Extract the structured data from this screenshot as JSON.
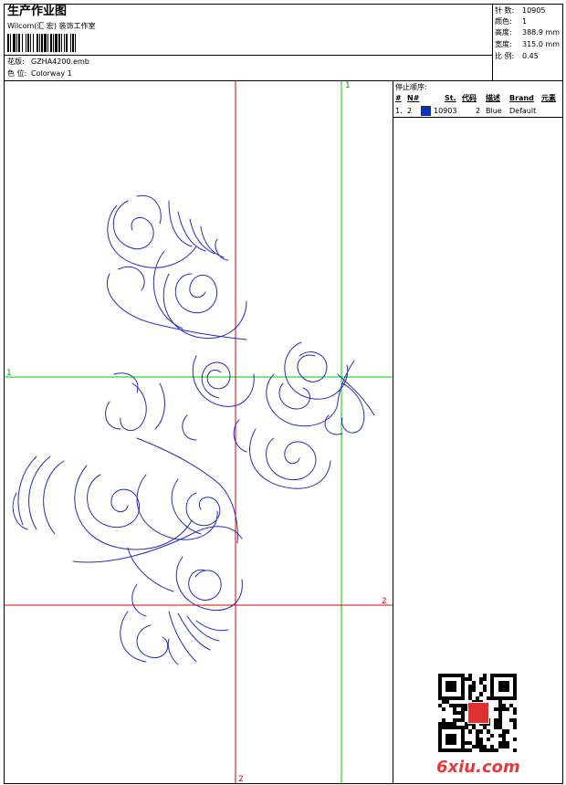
{
  "header": {
    "title": "生产作业图",
    "company": "Wilcom(汇 宏) 装饰工作室",
    "design_label": "花版:",
    "design_value": "GZHA4200.emb",
    "colorway_label": "色 位:",
    "colorway_value": "Colorway 1"
  },
  "specs": [
    {
      "label": "针 数:",
      "value": "10905"
    },
    {
      "label": "颜色:",
      "value": "1"
    },
    {
      "label": "高度:",
      "value": "388.9 mm"
    },
    {
      "label": "宽度:",
      "value": "315.0 mm"
    },
    {
      "label": "比 例:",
      "value": "0.45"
    }
  ],
  "stop_sequence": {
    "title": "停止顺序:",
    "columns": [
      "#",
      "N#",
      "St.",
      "代码",
      "描述",
      "Brand",
      "元素"
    ],
    "rows": [
      {
        "num": "1.",
        "n": "2",
        "color": "#0033cc",
        "stitches": "10903",
        "code": "2",
        "desc": "Blue",
        "brand": "Default"
      }
    ]
  },
  "axes": {
    "top_label": "1",
    "left_label": "1",
    "right_label": "2",
    "bottom_label": "2"
  },
  "colors": {
    "stitch": "#2a2ab8",
    "green_axis": "#00cc00",
    "red_axis": "#dd0000"
  },
  "watermark": {
    "site": "6xiu.com"
  }
}
